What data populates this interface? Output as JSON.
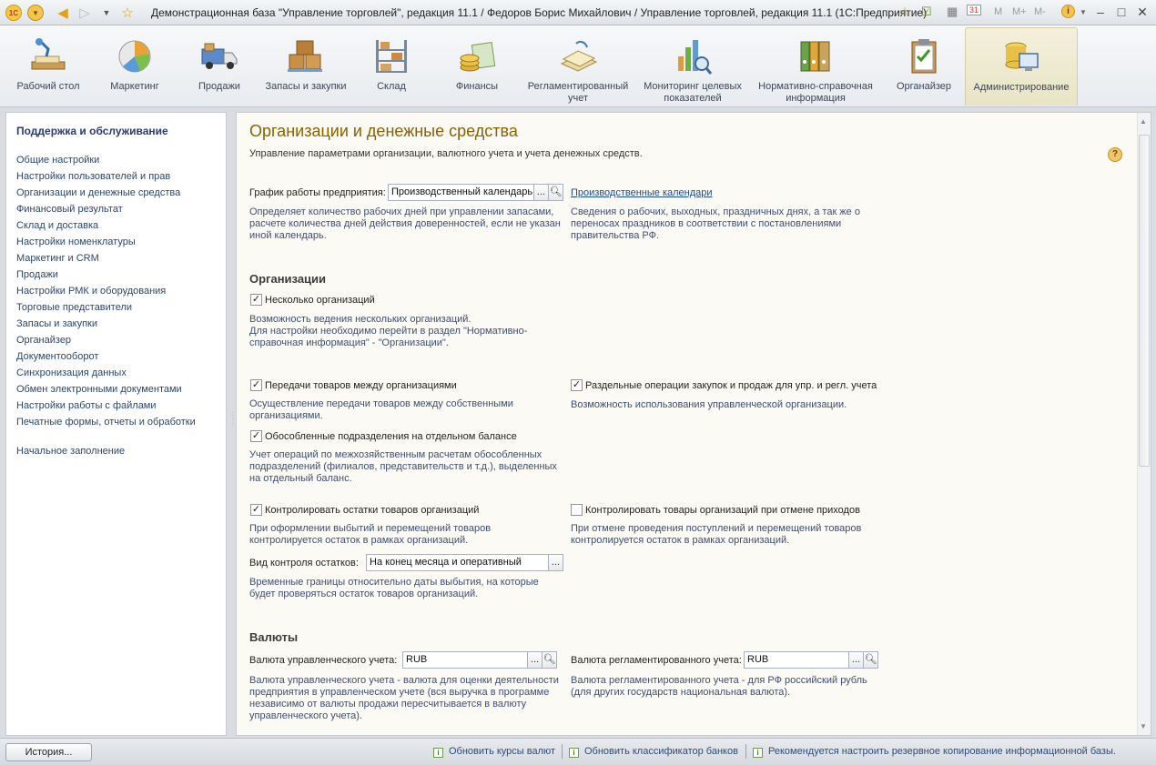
{
  "window": {
    "title": "Демонстрационная база \"Управление торговлей\", редакция 11.1 / Федоров Борис Михайлович / Управление торговлей, редакция 11.1  (1С:Предприятие)",
    "logo_text": "1C",
    "m_buttons": [
      "M",
      "M+",
      "M-"
    ],
    "info_icon": "i",
    "calendar_day": "31"
  },
  "sections": [
    {
      "label": "Рабочий стол",
      "icon": "desk-icon"
    },
    {
      "label": "Маркетинг",
      "icon": "pie-chart-icon"
    },
    {
      "label": "Продажи",
      "icon": "truck-icon"
    },
    {
      "label": "Запасы и закупки",
      "icon": "boxes-icon"
    },
    {
      "label": "Склад",
      "icon": "shelves-icon"
    },
    {
      "label": "Финансы",
      "icon": "coins-icon"
    },
    {
      "label": "Регламентированный учет",
      "icon": "papers-icon"
    },
    {
      "label": "Мониторинг целевых показателей",
      "icon": "bars-magnifier-icon"
    },
    {
      "label": "Нормативно-справочная информация",
      "icon": "binders-icon"
    },
    {
      "label": "Органайзер",
      "icon": "clipboard-icon"
    },
    {
      "label": "Администрирование",
      "icon": "database-computer-icon",
      "active": true
    }
  ],
  "leftnav": {
    "heading": "Поддержка и обслуживание",
    "items": [
      "Общие настройки",
      "Настройки пользователей и прав",
      "Организации и денежные средства",
      "Финансовый результат",
      "Склад и доставка",
      "Настройки номенклатуры",
      "Маркетинг и CRM",
      "Продажи",
      "Настройки РМК и оборудования",
      "Торговые представители",
      "Запасы и закупки",
      "Органайзер",
      "Документооборот",
      "Синхронизация данных",
      "Обмен электронными документами",
      "Настройки работы с файлами",
      "Печатные формы, отчеты и обработки"
    ],
    "extra_item": "Начальное заполнение"
  },
  "content": {
    "title": "Организации и денежные средства",
    "subtitle": "Управление параметрами организации,  валютного учета и учета денежных средств.",
    "help": "?",
    "schedule": {
      "label": "График работы предприятия:",
      "value": "Производственный календарь",
      "btn": "...",
      "link": "Производственные календари",
      "hint_left": "Определяет количество рабочих дней при управлении запасами, расчете количества дней действия доверенностей, если не указан иной календарь.",
      "hint_right": "Сведения о рабочих, выходных, праздничных днях, а так же о переносах праздников в соответствии с постановлениями правительства РФ."
    },
    "orgs": {
      "heading": "Организации",
      "several": {
        "label": "Несколько организаций",
        "checked": true,
        "hint": "Возможность ведения нескольких организаций.\nДля настройки необходимо перейти в раздел \"Нормативно-справочная информация\" - \"Организации\"."
      },
      "transfer": {
        "label": "Передачи товаров между организациями",
        "checked": true,
        "hint": "Осуществление передачи товаров между собственными организациями."
      },
      "separate_ops": {
        "label": "Раздельные операции закупок и продаж для упр. и регл. учета",
        "checked": true,
        "hint": "Возможность использования управленческой организации."
      },
      "divisions": {
        "label": "Обособленные подразделения на отдельном балансе",
        "checked": true,
        "hint": "Учет операций по межхозяйственным расчетам обособленных подразделений (филиалов, представительств и т.д.), выделенных на отдельный баланс."
      },
      "control_stock": {
        "label": "Контролировать остатки товаров организаций",
        "checked": true,
        "hint": "При оформлении выбытий и перемещений товаров контролируется остаток в рамках организаций."
      },
      "control_cancel": {
        "label": "Контролировать товары организаций при отмене приходов",
        "checked": false,
        "hint": "При отмене проведения поступлений и перемещений товаров контролируется остаток в рамках организаций."
      },
      "control_type": {
        "label": "Вид контроля остатков:",
        "value": "На конец месяца и оперативный",
        "btn": "...",
        "hint": "Временные границы относительно даты выбытия, на которые будет проверяться остаток товаров организаций."
      }
    },
    "currencies": {
      "heading": "Валюты",
      "mgmt": {
        "label": "Валюта управленческого учета:",
        "value": "RUB",
        "btn": "...",
        "hint": "Валюта управленческого учета - валюта для оценки деятельности предприятия в управленческом учете (вся выручка в программе независимо от валюты продажи пересчитывается в валюту управленческого учета)."
      },
      "reg": {
        "label": "Валюта регламентированного учета:",
        "value": "RUB",
        "btn": "...",
        "hint": "Валюта регламентированного учета - для РФ российский рубль (для других государств национальная валюта)."
      }
    }
  },
  "statusbar": {
    "history": "История...",
    "items": [
      "Обновить курсы валют",
      "Обновить классификатор банков",
      "Рекомендуется настроить резервное копирование информационной базы."
    ],
    "icon_glyph": "i"
  },
  "colors": {
    "title": "#8a6100",
    "link": "#1a4aa8",
    "hint": "#3f4e72",
    "active_section": "#ece7cc"
  }
}
